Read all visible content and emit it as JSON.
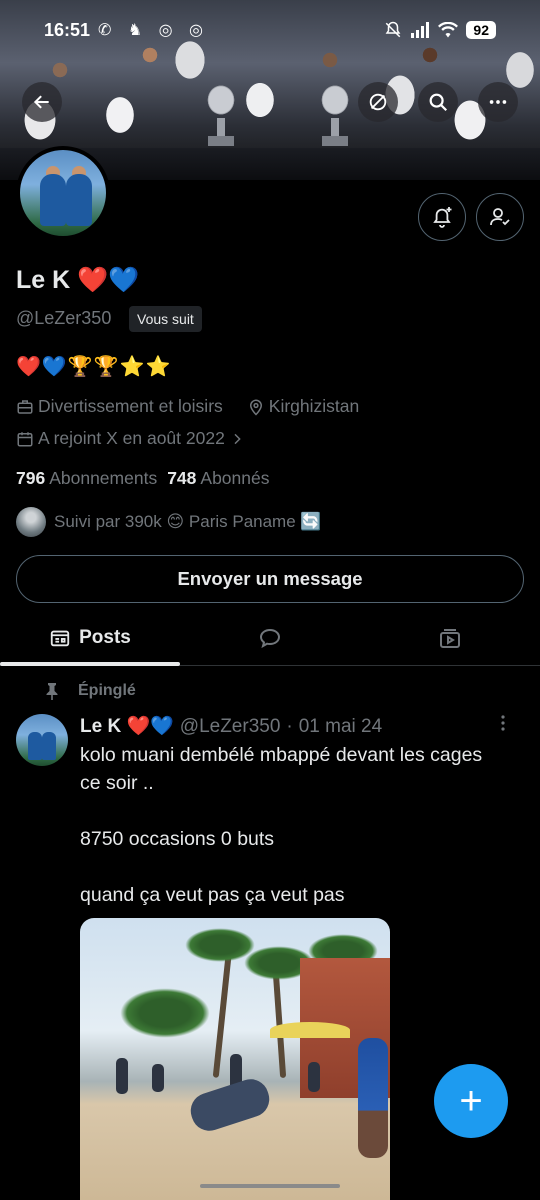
{
  "status_bar": {
    "time": "16:51",
    "left_icons": "✆ ♞ ◎ ◎",
    "battery": "92"
  },
  "profile": {
    "name": "Le K ❤️💙",
    "handle": "@LeZer350",
    "follows_you": "Vous suit",
    "bio": "❤️💙🏆🏆⭐⭐",
    "category": "Divertissement et loisirs",
    "location": "Kirghizistan",
    "joined": "A rejoint X en août 2022",
    "following_count": "796",
    "following_label": "Abonnements",
    "followers_count": "748",
    "followers_label": "Abonnés",
    "followed_by": "Suivi par 390k 😊 Paris Paname 🔄",
    "message_button": "Envoyer un message"
  },
  "tabs": [
    {
      "label": "Posts",
      "icon": "posts-icon",
      "active": true
    },
    {
      "label": "",
      "icon": "replies-icon",
      "active": false
    },
    {
      "label": "",
      "icon": "media-icon",
      "active": false
    }
  ],
  "tweet": {
    "pinned_label": "Épinglé",
    "author_name": "Le K ❤️💙",
    "author_handle": "@LeZer350",
    "separator": "·",
    "date": "01 mai 24",
    "text": "kolo muani dembélé mbappé devant les cages\nce soir ..\n\n8750 occasions 0 buts\n\nquand ça veut pas ça veut pas"
  },
  "fab": {
    "label": "+"
  },
  "colors": {
    "accent": "#1d9bf0",
    "background": "#000000",
    "text_primary": "#e7e9ea",
    "text_secondary": "#71767b",
    "border": "#536471"
  }
}
